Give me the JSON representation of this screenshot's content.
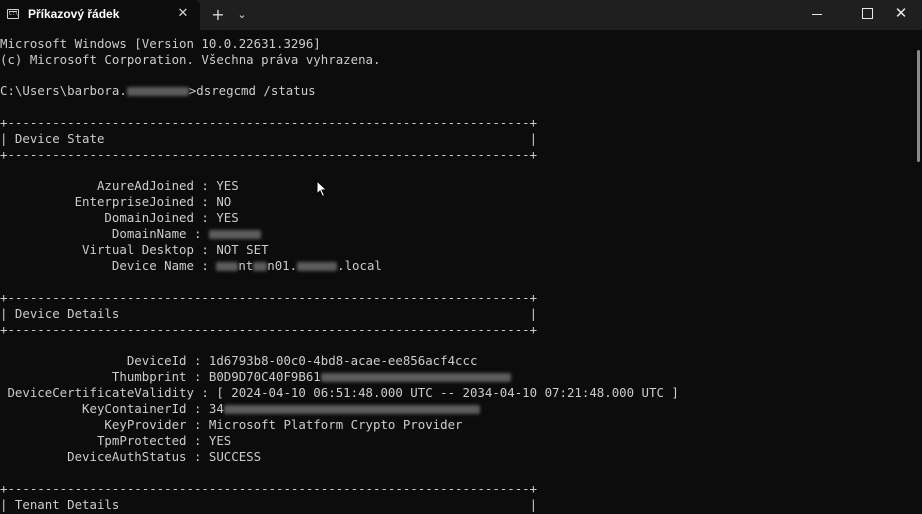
{
  "window": {
    "tab_title": "Příkazový řádek",
    "tab_icon": "cmd-icon",
    "tab_close": "✕",
    "new_tab": "+",
    "dropdown": "⌄",
    "close": "✕"
  },
  "terminal": {
    "bg_color": "#0c0c0c",
    "text_color": "#cccccc",
    "lines": {
      "l1": "Microsoft Windows [Version 10.0.22631.3296]",
      "l2": "(c) Microsoft Corporation. Všechna práva vyhrazena.",
      "prompt_user": "C:\\Users\\barbora.",
      "prompt_cmd": ">dsregcmd /status",
      "border": "+----------------------------------------------------------------------+",
      "section1": "| Device State                                                         |",
      "azure": "             AzureAdJoined : YES",
      "enterprise": "          EnterpriseJoined : NO",
      "domainjoined": "              DomainJoined : YES",
      "domainname": "               DomainName : ",
      "virtual": "           Virtual Desktop : NOT SET",
      "devicename_label": "               Device Name : ",
      "devicename_a": "nt",
      "devicename_b": "n01.",
      "devicename_c": ".local",
      "section2": "| Device Details                                                       |",
      "deviceid": "                 DeviceId : 1d6793b8-00c0-4bd8-acae-ee856acf4ccc",
      "thumbprint": "               Thumbprint : B0D9D70C40F9B61",
      "validity": " DeviceCertificateValidity : [ 2024-04-10 06:51:48.000 UTC -- 2034-04-10 07:21:48.000 UTC ]",
      "keycontainer": "           KeyContainerId : 34",
      "keyprovider": "              KeyProvider : Microsoft Platform Crypto Provider",
      "tpm": "             TpmProtected : YES",
      "authstatus": "         DeviceAuthStatus : SUCCESS",
      "section3": "| Tenant Details                                                       |"
    }
  }
}
